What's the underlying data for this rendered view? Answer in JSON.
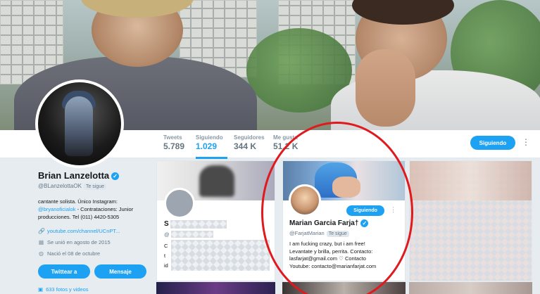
{
  "profile": {
    "name": "Brian Lanzelotta",
    "handle": "@BLanzelottaOK",
    "follows_you": "Te sigue",
    "bio_line1": "cantante solista. Único Instagram:",
    "bio_instagram": "@bryanoficialok",
    "bio_line2": " - Contrataciones: Junior",
    "bio_line3": "producciones. Tel (011) 4420-5305",
    "link": "youtube.com/channel/UCnPT...",
    "joined": "Se unió en agosto de 2015",
    "born": "Nació el 08 de octubre",
    "tweet_to_label": "Twittear a",
    "message_label": "Mensaje",
    "photos_label": "633 fotos y videos"
  },
  "stats": [
    {
      "label": "Tweets",
      "value": "5.789"
    },
    {
      "label": "Siguiendo",
      "value": "1.029"
    },
    {
      "label": "Seguidores",
      "value": "344 K"
    },
    {
      "label": "Me gusta",
      "value": "51,2 K"
    }
  ],
  "nav": {
    "following_label": "Siguiendo",
    "more_label": "⋮"
  },
  "cards": {
    "first": {
      "name_partial": "S",
      "handle_partial": "@",
      "bio_partial": [
        "C",
        "t",
        "id"
      ]
    },
    "featured": {
      "name": "Marian Garcia Farja†",
      "handle": "@FarjatMarian",
      "follows_you": "Te sigue",
      "follow_label": "Siguiendo",
      "bio": [
        "I am fucking crazy, but i am free!",
        "Levantate y brilla, perrita. Contacto:",
        "lasfarjat@gmail.com ♡ Contacto",
        "Youtube: contacto@marianfarjat.com"
      ]
    }
  },
  "colors": {
    "accent": "#1da1f2",
    "highlight_circle": "#e0191e",
    "background": "#e6ecf0"
  },
  "icons": {
    "link": "link-icon",
    "joined": "calendar-icon",
    "born": "balloon-icon",
    "photos": "image-icon",
    "verified": "verified-badge-icon"
  }
}
